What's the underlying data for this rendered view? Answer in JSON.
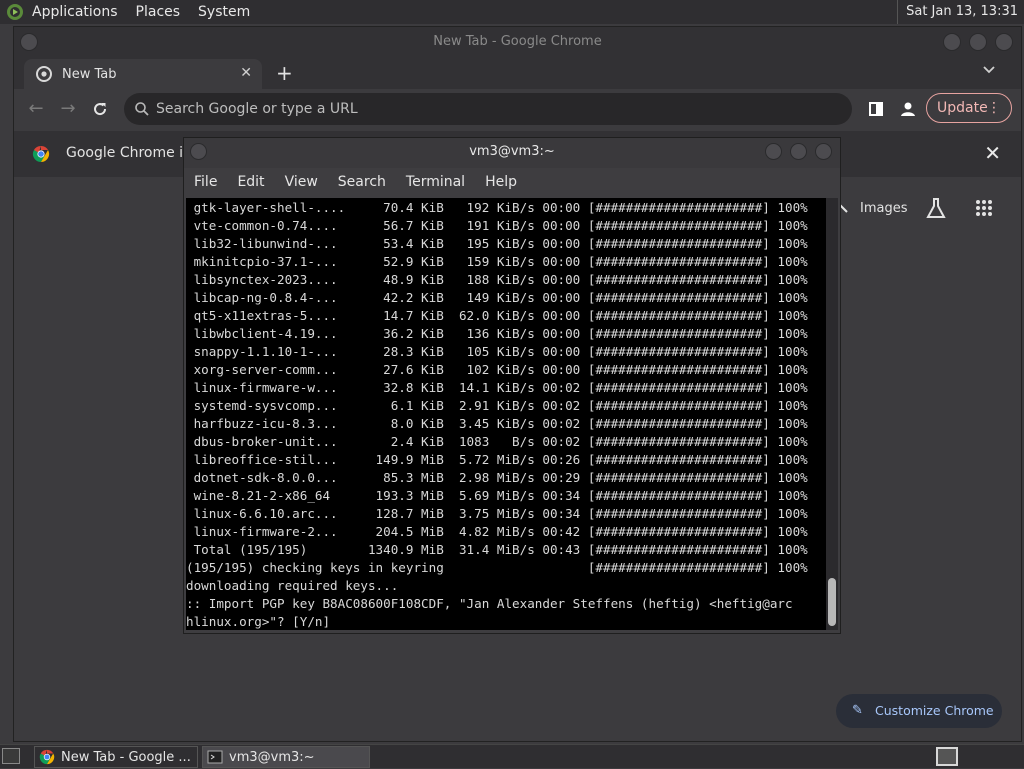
{
  "top_panel": {
    "menus": [
      "Applications",
      "Places",
      "System"
    ],
    "clock": "Sat Jan 13, 13:31"
  },
  "chrome": {
    "window_title": "New Tab - Google Chrome",
    "tab_title": "New Tab",
    "omnibox_placeholder": "Search Google or type a URL",
    "update_label": "Update",
    "infobar_text": "Google Chrome isn",
    "images_link": "Images",
    "customize_label": "Customize Chrome",
    "accent_color": "#a8c7fa",
    "update_color": "#f2b8b5"
  },
  "terminal": {
    "title": "vm3@vm3:~",
    "menus": [
      "File",
      "Edit",
      "View",
      "Search",
      "Terminal",
      "Help"
    ],
    "lines": [
      " gtk-layer-shell-....     70.4 KiB   192 KiB/s 00:00 [######################] 100%",
      " vte-common-0.74....      56.7 KiB   191 KiB/s 00:00 [######################] 100%",
      " lib32-libunwind-...      53.4 KiB   195 KiB/s 00:00 [######################] 100%",
      " mkinitcpio-37.1-...      52.9 KiB   159 KiB/s 00:00 [######################] 100%",
      " libsynctex-2023....      48.9 KiB   188 KiB/s 00:00 [######################] 100%",
      " libcap-ng-0.8.4-...      42.2 KiB   149 KiB/s 00:00 [######################] 100%",
      " qt5-x11extras-5....      14.7 KiB  62.0 KiB/s 00:00 [######################] 100%",
      " libwbclient-4.19...      36.2 KiB   136 KiB/s 00:00 [######################] 100%",
      " snappy-1.1.10-1-...      28.3 KiB   105 KiB/s 00:00 [######################] 100%",
      " xorg-server-comm...      27.6 KiB   102 KiB/s 00:00 [######################] 100%",
      " linux-firmware-w...      32.8 KiB  14.1 KiB/s 00:02 [######################] 100%",
      " systemd-sysvcomp...       6.1 KiB  2.91 KiB/s 00:02 [######################] 100%",
      " harfbuzz-icu-8.3...       8.0 KiB  3.45 KiB/s 00:02 [######################] 100%",
      " dbus-broker-unit...       2.4 KiB  1083   B/s 00:02 [######################] 100%",
      " libreoffice-stil...     149.9 MiB  5.72 MiB/s 00:26 [######################] 100%",
      " dotnet-sdk-8.0.0...      85.3 MiB  2.98 MiB/s 00:29 [######################] 100%",
      " wine-8.21-2-x86_64      193.3 MiB  5.69 MiB/s 00:34 [######################] 100%",
      " linux-6.6.10.arc...     128.7 MiB  3.75 MiB/s 00:34 [######################] 100%",
      " linux-firmware-2...     204.5 MiB  4.82 MiB/s 00:42 [######################] 100%",
      " Total (195/195)        1340.9 MiB  31.4 MiB/s 00:43 [######################] 100%",
      "(195/195) checking keys in keyring                   [######################] 100%",
      "downloading required keys...",
      ":: Import PGP key B8AC08600F108CDF, \"Jan Alexander Steffens (heftig) <heftig@arc",
      "hlinux.org>\"? [Y/n]"
    ]
  },
  "taskbar": {
    "tasks": [
      "New Tab - Google ...",
      "vm3@vm3:~"
    ]
  }
}
